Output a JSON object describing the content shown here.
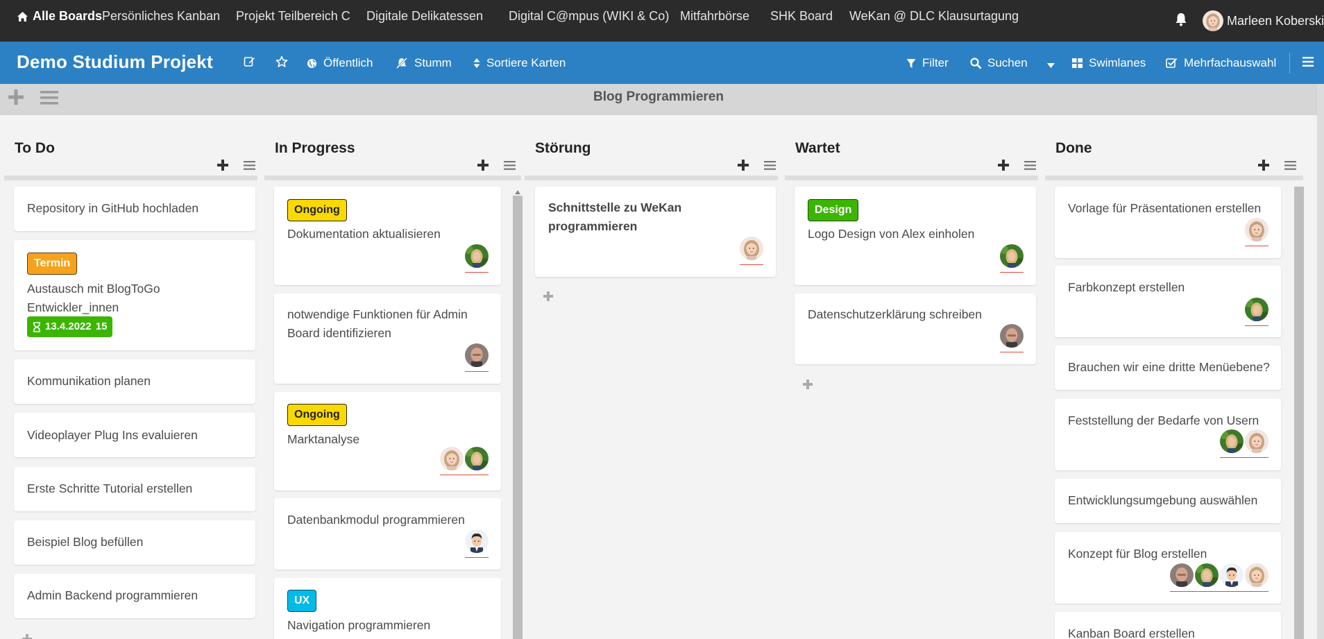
{
  "topnav": {
    "home_label": "Alle Boards",
    "boards": [
      "Persönliches Kanban",
      "Projekt Teilbereich C",
      "Digitale Delikatessen",
      "Digital C@mpus (WIKI & Co)",
      "Mitfahrbörse",
      "SHK Board",
      "WeKan @ DLC Klausurtagung"
    ],
    "username": "Marleen Koberski"
  },
  "board": {
    "title": "Demo Studium Projekt",
    "visibility_label": "Öffentlich",
    "mute_label": "Stumm",
    "sort_label": "Sortiere Karten",
    "filter_label": "Filter",
    "search_label": "Suchen",
    "view_label": "Swimlanes",
    "multiselect_label": "Mehrfachauswahl"
  },
  "swimlane": {
    "title": "Blog Programmieren"
  },
  "lists": [
    {
      "title": "To Do",
      "cards": [
        {
          "title": "Repository in GitHub hochladen"
        },
        {
          "label": "Termin",
          "title": "Austausch mit BlogToGo Entwickler_innen",
          "due": "13.4.2022",
          "due_time": "15"
        },
        {
          "title": "Kommunikation planen"
        },
        {
          "title": "Videoplayer Plug Ins evaluieren"
        },
        {
          "title": "Erste Schritte Tutorial erstellen"
        },
        {
          "title": "Beispiel Blog befüllen"
        },
        {
          "title": "Admin Backend programmieren"
        }
      ]
    },
    {
      "title": "In Progress",
      "cards": [
        {
          "label": "Ongoing",
          "title": "Dokumentation aktualisieren"
        },
        {
          "title": "notwendige Funktionen für Admin Board identifizieren"
        },
        {
          "label": "Ongoing",
          "title": "Marktanalyse"
        },
        {
          "title": "Datenbankmodul programmieren"
        },
        {
          "label": "UX",
          "title": "Navigation programmieren"
        }
      ]
    },
    {
      "title": "Störung",
      "cards": [
        {
          "title": "Schnittstelle zu WeKan programmieren"
        }
      ]
    },
    {
      "title": "Wartet",
      "cards": [
        {
          "label": "Design",
          "title": "Logo Design von Alex einholen"
        },
        {
          "title": "Datenschutzerklärung schreiben"
        }
      ]
    },
    {
      "title": "Done",
      "cards": [
        {
          "title": "Vorlage für Präsentationen erstellen"
        },
        {
          "title": "Farbkonzept erstellen"
        },
        {
          "title": "Brauchen wir eine dritte Menüebene?"
        },
        {
          "title": "Feststellung der Bedarfe von Usern"
        },
        {
          "title": "Entwicklungsumgebung auswählen"
        },
        {
          "title": "Konzept für Blog erstellen"
        },
        {
          "title": "Kanban Board erstellen"
        }
      ]
    }
  ],
  "colors": {
    "topnav_bg": "#2b2b2b",
    "header_bg": "#2c81c4",
    "label_ongoing": "#fad900",
    "label_termin": "#f7a21d",
    "label_design": "#3cb500",
    "label_ux": "#00bbe8",
    "due_bg": "#3cb500"
  }
}
